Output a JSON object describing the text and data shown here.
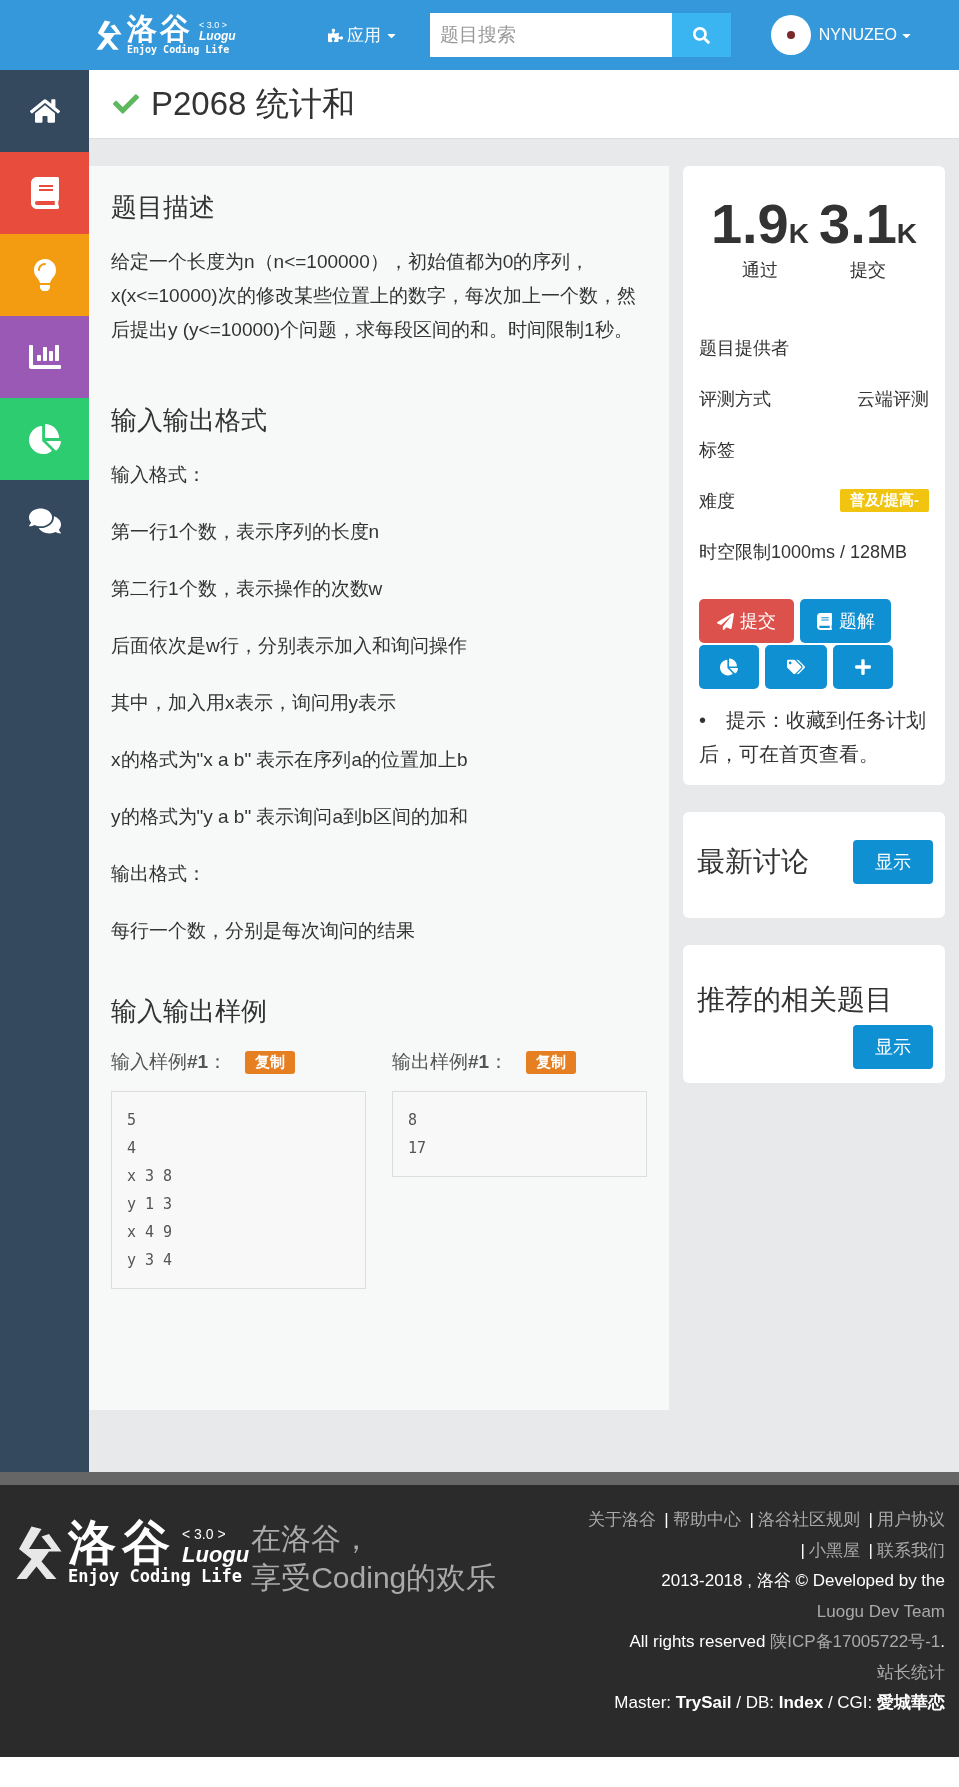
{
  "header": {
    "logo": {
      "name": "洛谷",
      "version": "< 3.0 >",
      "latin": "Luogu",
      "tagline": "Enjoy Coding Life"
    },
    "apps_menu": "应用",
    "search": {
      "placeholder": "题目搜索"
    },
    "user": "NYNUZEO"
  },
  "sidebar": {
    "items": [
      {
        "color": "#34495e"
      },
      {
        "color": "#e74c3c"
      },
      {
        "color": "#f39c12"
      },
      {
        "color": "#9b59b6"
      },
      {
        "color": "#2ecc71"
      },
      {
        "color": "#34495e"
      }
    ]
  },
  "problem": {
    "title": "P2068 统计和",
    "solved": true
  },
  "sections": [
    {
      "heading": "题目描述",
      "paragraphs": [
        "给定一个长度为n（n<=100000），初始值都为0的序列，x(x<=10000)次的修改某些位置上的数字，每次加上一个数，然后提出y (y<=10000)个问题，求每段区间的和。时间限制1秒。"
      ]
    },
    {
      "heading": "输入输出格式",
      "paragraphs": [
        "输入格式：",
        "第一行1个数，表示序列的长度n",
        "第二行1个数，表示操作的次数w",
        "后面依次是w行，分别表示加入和询问操作",
        "其中，加入用x表示，询问用y表示",
        "x的格式为\"x a b\" 表示在序列a的位置加上b",
        "y的格式为\"y a b\" 表示询问a到b区间的加和",
        "输出格式：",
        "每行一个数，分别是每次询问的结果"
      ]
    }
  ],
  "samples": {
    "heading": "输入输出样例",
    "items": [
      {
        "label": "输入样例**#1**：",
        "copy": "复制",
        "lines": [
          "5",
          "4",
          "x 3 8",
          "y 1 3",
          "x 4 9",
          "y 3 4"
        ]
      },
      {
        "label": "输出样例**#1**：",
        "copy": "复制",
        "lines": [
          "8",
          "17"
        ]
      }
    ]
  },
  "stats": [
    {
      "value": "1.9",
      "unit": "K",
      "label": "通过"
    },
    {
      "value": "3.1",
      "unit": "K",
      "label": "提交"
    }
  ],
  "info": [
    {
      "kind": "plain",
      "label": "题目提供者"
    },
    {
      "kind": "value",
      "label": "评测方式",
      "value": "云端评测"
    },
    {
      "kind": "plain",
      "label": "标签"
    },
    {
      "kind": "badge",
      "label": "难度",
      "value": "普及/提高-",
      "color": "#f1c40f"
    },
    {
      "kind": "plain",
      "label": "时空限制1000ms / 128MB"
    }
  ],
  "actions": [
    {
      "label": "提交",
      "color": "#dd514c"
    },
    {
      "label": "题解",
      "color": "#0e90d2"
    }
  ],
  "hint": {
    "bullet": "•",
    "text": "提示：收藏到任务计划后，可在首页查看。"
  },
  "cards": [
    {
      "title": "最新讨论",
      "button": "显示",
      "kind": "inline"
    },
    {
      "title": "推荐的相关题目",
      "button": "显示",
      "kind": "stacked"
    }
  ],
  "footer": {
    "logo": {
      "name": "洛谷",
      "version": "< 3.0 >",
      "latin": "Luogu",
      "tagline": "Enjoy Coding Life"
    },
    "slogan": [
      "在洛谷，",
      "享受Coding的欢乐"
    ],
    "links": [
      "关于洛谷",
      "帮助中心",
      "洛谷社区规则",
      "用户协议",
      "小黑屋",
      "联系我们"
    ],
    "separator": "|",
    "copyright": "2013-2018 , 洛谷 © Developed by the",
    "team_link": "Luogu Dev Team",
    "rights": "All rights reserved",
    "icp_link": "陕ICP备17005722号-1",
    "rights_end": ".",
    "stats_link": "站长统计",
    "servers": "Master: **TrySail** / DB: **Index** / CGI: **愛城華恋**"
  }
}
